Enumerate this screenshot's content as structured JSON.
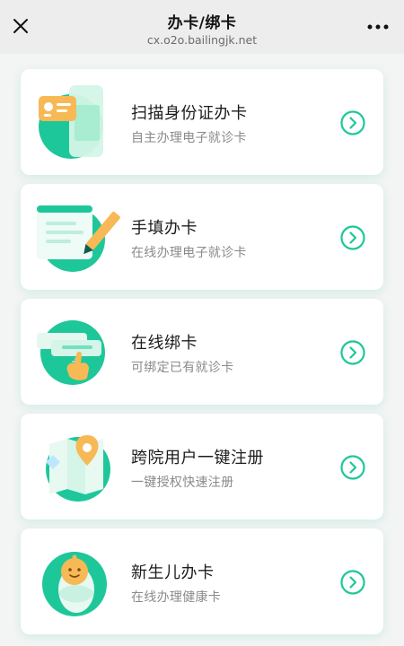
{
  "header": {
    "title": "办卡/绑卡",
    "url": "cx.o2o.bailingjk.net",
    "close_icon": "close-icon",
    "more_icon": "more-icon"
  },
  "colors": {
    "accent": "#1ec799",
    "accent_light": "#bff1df",
    "card_gold": "#f7b955"
  },
  "cards": [
    {
      "title": "扫描身份证办卡",
      "desc": "自主办理电子就诊卡",
      "icon": "id-card-scan-icon"
    },
    {
      "title": "手填办卡",
      "desc": "在线办理电子就诊卡",
      "icon": "form-pen-icon"
    },
    {
      "title": "在线绑卡",
      "desc": "可绑定已有就诊卡",
      "icon": "bind-card-hand-icon"
    },
    {
      "title": "跨院用户一键注册",
      "desc": "一键授权快速注册",
      "icon": "map-pin-icon"
    },
    {
      "title": "新生儿办卡",
      "desc": "在线办理健康卡",
      "icon": "newborn-baby-icon"
    }
  ]
}
